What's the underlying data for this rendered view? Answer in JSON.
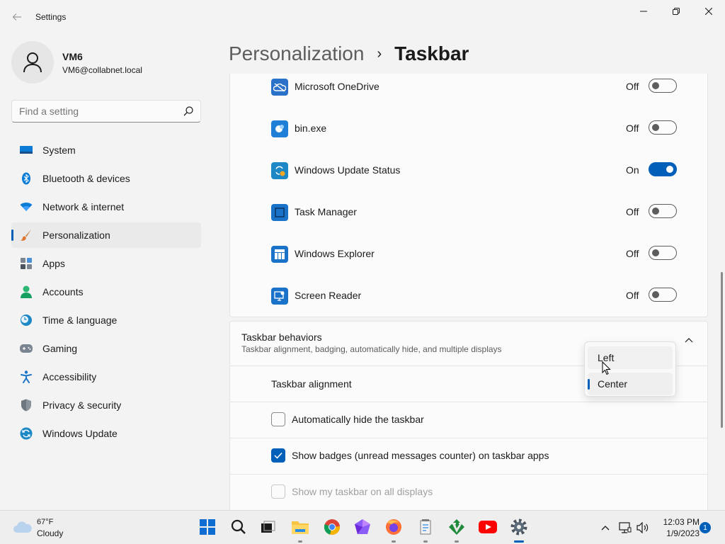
{
  "window": {
    "title": "Settings",
    "back_icon": "back-arrow-icon",
    "controls": [
      "minimize",
      "maximize",
      "close"
    ]
  },
  "profile": {
    "name": "VM6",
    "email": "VM6@collabnet.local"
  },
  "search": {
    "placeholder": "Find a setting",
    "value": ""
  },
  "sidebar": {
    "items": [
      {
        "label": "System",
        "icon": "system-icon",
        "active": false
      },
      {
        "label": "Bluetooth & devices",
        "icon": "bluetooth-icon",
        "active": false
      },
      {
        "label": "Network & internet",
        "icon": "wifi-icon",
        "active": false
      },
      {
        "label": "Personalization",
        "icon": "paintbrush-icon",
        "active": true
      },
      {
        "label": "Apps",
        "icon": "apps-icon",
        "active": false
      },
      {
        "label": "Accounts",
        "icon": "person-icon",
        "active": false
      },
      {
        "label": "Time & language",
        "icon": "clock-globe-icon",
        "active": false
      },
      {
        "label": "Gaming",
        "icon": "gamepad-icon",
        "active": false
      },
      {
        "label": "Accessibility",
        "icon": "accessibility-icon",
        "active": false
      },
      {
        "label": "Privacy & security",
        "icon": "shield-icon",
        "active": false
      },
      {
        "label": "Windows Update",
        "icon": "update-icon",
        "active": false
      }
    ]
  },
  "breadcrumb": {
    "parent": "Personalization",
    "separator": "›",
    "current": "Taskbar"
  },
  "tray_apps": [
    {
      "name": "Microsoft OneDrive",
      "state": "Off",
      "on": false
    },
    {
      "name": "bin.exe",
      "state": "Off",
      "on": false
    },
    {
      "name": "Windows Update Status",
      "state": "On",
      "on": true
    },
    {
      "name": "Task Manager",
      "state": "Off",
      "on": false
    },
    {
      "name": "Windows Explorer",
      "state": "Off",
      "on": false
    },
    {
      "name": "Screen Reader",
      "state": "Off",
      "on": false
    }
  ],
  "behaviors": {
    "title": "Taskbar behaviors",
    "subtitle": "Taskbar alignment, badging, automatically hide, and multiple displays",
    "alignment_label": "Taskbar alignment",
    "alignment_options": [
      "Left",
      "Center"
    ],
    "alignment_selected": "Center",
    "auto_hide": {
      "label": "Automatically hide the taskbar",
      "checked": false
    },
    "badges": {
      "label": "Show badges (unread messages counter) on taskbar apps",
      "checked": true
    },
    "all_displays": {
      "label": "Show my taskbar on all displays",
      "checked": false,
      "disabled": true
    }
  },
  "taskbar": {
    "weather": {
      "temp": "67°F",
      "condition": "Cloudy"
    },
    "apps": [
      "start-icon",
      "search-icon",
      "task-view-icon",
      "file-explorer-icon",
      "chrome-icon",
      "app-gem-icon",
      "firefox-icon",
      "notepad-icon",
      "vim-icon",
      "youtube-icon",
      "settings-icon"
    ],
    "time": "12:03 PM",
    "date": "1/9/2023",
    "notifications": "1"
  },
  "colors": {
    "accent": "#005fb8",
    "background": "#f3f3f3",
    "card": "#fbfbfb"
  }
}
